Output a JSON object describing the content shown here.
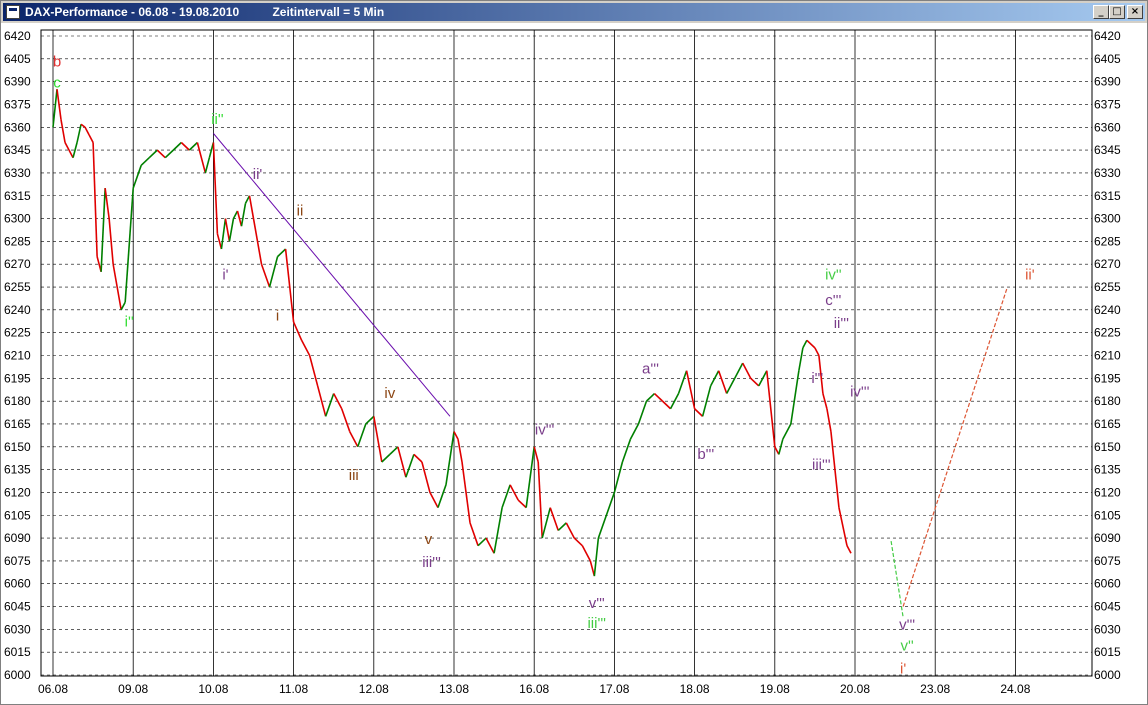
{
  "window": {
    "title": "DAX-Performance - 06.08 - 19.08.2010          Zeitintervall = 5 Min",
    "buttons": {
      "minimize": "_",
      "maximize": "□",
      "close": "×"
    }
  },
  "colors": {
    "plot_bg": "#ffffff",
    "candle_up": "#008000",
    "candle_down": "#e00000",
    "trend_line": "#6a0dad",
    "red": "#e03030",
    "green": "#33dd33",
    "purple": "#7a3d8a",
    "brown": "#8b4513",
    "orange": "#dd5533",
    "lime": "#44cc44"
  },
  "chart_data": {
    "type": "line",
    "title": "DAX-Performance",
    "ylim": [
      6000,
      6420
    ],
    "y_ticks": [
      6420,
      6405,
      6390,
      6375,
      6360,
      6345,
      6330,
      6315,
      6300,
      6285,
      6270,
      6255,
      6240,
      6225,
      6210,
      6195,
      6180,
      6165,
      6150,
      6135,
      6120,
      6105,
      6090,
      6075,
      6060,
      6045,
      6030,
      6015,
      6000
    ],
    "x_ticks": [
      "06.08",
      "09.08",
      "10.08",
      "11.08",
      "12.08",
      "13.08",
      "16.08",
      "17.08",
      "18.08",
      "19.08",
      "20.08",
      "23.08",
      "24.08"
    ],
    "grid": {
      "vertical": "solid",
      "horizontal": "dashed"
    },
    "series": [
      {
        "values": [
          [
            0,
            6360
          ],
          [
            0.05,
            6385
          ],
          [
            0.1,
            6365
          ],
          [
            0.15,
            6350
          ],
          [
            0.2,
            6345
          ],
          [
            0.25,
            6340
          ],
          [
            0.3,
            6350
          ],
          [
            0.35,
            6362
          ],
          [
            0.4,
            6360
          ],
          [
            0.45,
            6355
          ],
          [
            0.5,
            6350
          ],
          [
            0.55,
            6275
          ],
          [
            0.6,
            6265
          ],
          [
            0.65,
            6320
          ],
          [
            0.7,
            6300
          ],
          [
            0.75,
            6270
          ],
          [
            0.8,
            6255
          ],
          [
            0.85,
            6240
          ],
          [
            0.9,
            6245
          ],
          [
            1.0,
            6320
          ],
          [
            1.1,
            6335
          ],
          [
            1.2,
            6340
          ],
          [
            1.3,
            6345
          ],
          [
            1.4,
            6340
          ],
          [
            1.5,
            6345
          ],
          [
            1.6,
            6350
          ],
          [
            1.7,
            6345
          ],
          [
            1.8,
            6350
          ],
          [
            1.9,
            6330
          ],
          [
            1.95,
            6340
          ],
          [
            2.0,
            6350
          ],
          [
            2.05,
            6290
          ],
          [
            2.1,
            6280
          ],
          [
            2.15,
            6300
          ],
          [
            2.2,
            6285
          ],
          [
            2.25,
            6300
          ],
          [
            2.3,
            6305
          ],
          [
            2.35,
            6295
          ],
          [
            2.4,
            6310
          ],
          [
            2.45,
            6315
          ],
          [
            2.5,
            6300
          ],
          [
            2.6,
            6270
          ],
          [
            2.7,
            6255
          ],
          [
            2.8,
            6275
          ],
          [
            2.9,
            6280
          ],
          [
            3.0,
            6232
          ],
          [
            3.1,
            6220
          ],
          [
            3.2,
            6210
          ],
          [
            3.3,
            6190
          ],
          [
            3.4,
            6170
          ],
          [
            3.5,
            6185
          ],
          [
            3.6,
            6175
          ],
          [
            3.7,
            6160
          ],
          [
            3.8,
            6150
          ],
          [
            3.9,
            6165
          ],
          [
            4.0,
            6170
          ],
          [
            4.1,
            6140
          ],
          [
            4.2,
            6145
          ],
          [
            4.3,
            6150
          ],
          [
            4.4,
            6130
          ],
          [
            4.5,
            6145
          ],
          [
            4.6,
            6140
          ],
          [
            4.7,
            6120
          ],
          [
            4.8,
            6110
          ],
          [
            4.9,
            6125
          ],
          [
            5.0,
            6160
          ],
          [
            5.05,
            6155
          ],
          [
            5.1,
            6140
          ],
          [
            5.2,
            6100
          ],
          [
            5.3,
            6085
          ],
          [
            5.4,
            6090
          ],
          [
            5.5,
            6080
          ],
          [
            5.6,
            6110
          ],
          [
            5.7,
            6125
          ],
          [
            5.8,
            6115
          ],
          [
            5.9,
            6110
          ],
          [
            6.0,
            6150
          ],
          [
            6.05,
            6140
          ],
          [
            6.1,
            6090
          ],
          [
            6.2,
            6110
          ],
          [
            6.3,
            6095
          ],
          [
            6.4,
            6100
          ],
          [
            6.5,
            6090
          ],
          [
            6.6,
            6085
          ],
          [
            6.7,
            6075
          ],
          [
            6.75,
            6065
          ],
          [
            6.8,
            6090
          ],
          [
            6.9,
            6105
          ],
          [
            7.0,
            6120
          ],
          [
            7.1,
            6140
          ],
          [
            7.2,
            6155
          ],
          [
            7.3,
            6165
          ],
          [
            7.4,
            6180
          ],
          [
            7.5,
            6185
          ],
          [
            7.6,
            6180
          ],
          [
            7.7,
            6175
          ],
          [
            7.8,
            6185
          ],
          [
            7.9,
            6200
          ],
          [
            8.0,
            6175
          ],
          [
            8.1,
            6170
          ],
          [
            8.2,
            6190
          ],
          [
            8.3,
            6200
          ],
          [
            8.4,
            6185
          ],
          [
            8.5,
            6195
          ],
          [
            8.6,
            6205
          ],
          [
            8.7,
            6195
          ],
          [
            8.8,
            6190
          ],
          [
            8.9,
            6200
          ],
          [
            9.0,
            6150
          ],
          [
            9.05,
            6145
          ],
          [
            9.1,
            6155
          ],
          [
            9.2,
            6165
          ],
          [
            9.3,
            6200
          ],
          [
            9.35,
            6215
          ],
          [
            9.4,
            6220
          ],
          [
            9.5,
            6215
          ],
          [
            9.55,
            6210
          ],
          [
            9.6,
            6185
          ],
          [
            9.65,
            6175
          ],
          [
            9.7,
            6160
          ],
          [
            9.8,
            6110
          ],
          [
            9.9,
            6085
          ],
          [
            9.95,
            6080
          ]
        ]
      }
    ],
    "trend_lines": [
      {
        "from": [
          2.0,
          6356
        ],
        "to": [
          4.95,
          6170
        ]
      }
    ],
    "projections": [
      {
        "from": [
          10.45,
          6088
        ],
        "to": [
          10.6,
          6038
        ],
        "color": "lime"
      },
      {
        "from": [
          10.6,
          6045
        ],
        "to": [
          11.9,
          6255
        ],
        "color": "orange"
      }
    ],
    "annotations": [
      {
        "text": "b",
        "x": 0.05,
        "y": 6404,
        "color": "red"
      },
      {
        "text": "c",
        "x": 0.05,
        "y": 6390,
        "color": "green"
      },
      {
        "text": "i''",
        "x": 0.95,
        "y": 6233,
        "color": "green"
      },
      {
        "text": "ii''",
        "x": 2.05,
        "y": 6366,
        "color": "green"
      },
      {
        "text": "ii'",
        "x": 2.55,
        "y": 6330,
        "color": "purple"
      },
      {
        "text": "i'",
        "x": 2.15,
        "y": 6264,
        "color": "purple"
      },
      {
        "text": "i",
        "x": 2.8,
        "y": 6237,
        "color": "brown"
      },
      {
        "text": "ii",
        "x": 3.08,
        "y": 6306,
        "color": "brown"
      },
      {
        "text": "iv",
        "x": 4.2,
        "y": 6186,
        "color": "brown"
      },
      {
        "text": "iii",
        "x": 3.75,
        "y": 6132,
        "color": "brown"
      },
      {
        "text": "v",
        "x": 4.68,
        "y": 6090,
        "color": "brown"
      },
      {
        "text": "iii'''",
        "x": 4.72,
        "y": 6075,
        "color": "purple"
      },
      {
        "text": "iv'''",
        "x": 6.13,
        "y": 6162,
        "color": "purple"
      },
      {
        "text": "v'''",
        "x": 6.78,
        "y": 6048,
        "color": "purple"
      },
      {
        "text": "iii'''",
        "x": 6.78,
        "y": 6035,
        "color": "lime"
      },
      {
        "text": "a'''",
        "x": 7.45,
        "y": 6202,
        "color": "purple"
      },
      {
        "text": "b'''",
        "x": 8.14,
        "y": 6146,
        "color": "purple"
      },
      {
        "text": "iv''",
        "x": 9.73,
        "y": 6264,
        "color": "lime"
      },
      {
        "text": "c'''",
        "x": 9.73,
        "y": 6247,
        "color": "purple"
      },
      {
        "text": "ii'''",
        "x": 9.83,
        "y": 6232,
        "color": "purple"
      },
      {
        "text": "i'''",
        "x": 9.53,
        "y": 6196,
        "color": "purple"
      },
      {
        "text": "iv'''",
        "x": 10.06,
        "y": 6187,
        "color": "purple"
      },
      {
        "text": "iii'''",
        "x": 9.58,
        "y": 6139,
        "color": "purple"
      },
      {
        "text": "v'''",
        "x": 10.65,
        "y": 6034,
        "color": "purple"
      },
      {
        "text": "v''",
        "x": 10.65,
        "y": 6020,
        "color": "lime"
      },
      {
        "text": "i'",
        "x": 10.6,
        "y": 6005,
        "color": "orange"
      },
      {
        "text": "ii'",
        "x": 12.18,
        "y": 6264,
        "color": "orange"
      }
    ]
  }
}
